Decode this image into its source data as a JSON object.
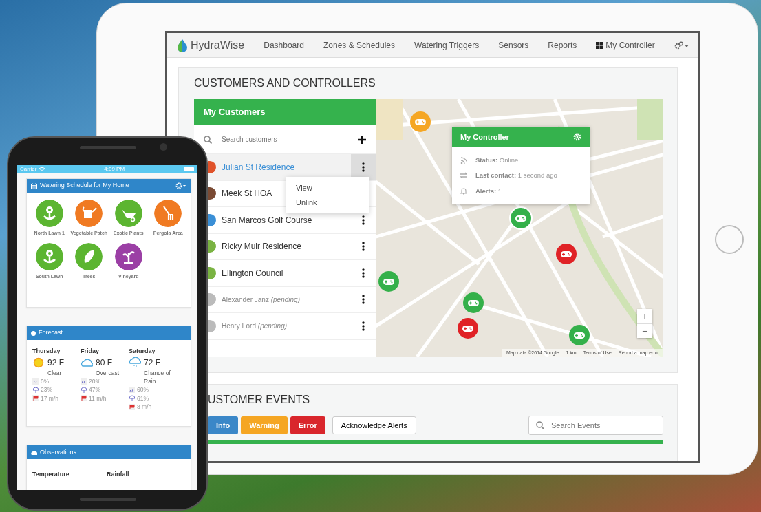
{
  "tablet": {
    "navbar": {
      "brand": "HydraWise",
      "items": [
        "Dashboard",
        "Zones & Schedules",
        "Watering Triggers",
        "Sensors",
        "Reports"
      ],
      "controller": "My Controller"
    },
    "customers_section": {
      "title": "CUSTOMERS AND CONTROLLERS",
      "list_title": "My Customers",
      "search": {
        "placeholder": "Search customers"
      },
      "customers": [
        {
          "name": "Julian St Residence",
          "color": "#e0522a",
          "selected": true,
          "pending": false
        },
        {
          "name": "Meek St HOA",
          "color": "#7a4a33",
          "selected": false,
          "pending": false
        },
        {
          "name": "San Marcos Golf Course",
          "color": "#3a8fd6",
          "selected": false,
          "pending": false
        },
        {
          "name": "Ricky Muir Residence",
          "color": "#7ab342",
          "selected": false,
          "pending": false
        },
        {
          "name": "Ellington Council",
          "color": "#7ab342",
          "selected": false,
          "pending": false
        },
        {
          "name": "Alexander Janz *(pending)*",
          "color": "#bbbbbb",
          "selected": false,
          "pending": true
        },
        {
          "name": "Henry Ford *(pending)*",
          "color": "#bbbbbb",
          "selected": false,
          "pending": true
        }
      ],
      "context_menu": [
        "View",
        "Unlink"
      ],
      "map": {
        "markers": [
          {
            "color": "#f5a623",
            "selected": false
          },
          {
            "color": "#34b04a",
            "selected": true
          },
          {
            "color": "#e02226",
            "selected": false
          },
          {
            "color": "#34b04a",
            "selected": false
          },
          {
            "color": "#34b04a",
            "selected": false
          },
          {
            "color": "#e02226",
            "selected": false
          },
          {
            "color": "#34b04a",
            "selected": false
          }
        ],
        "popup": {
          "title": "My Controller",
          "rows": [
            "**Status:** Online",
            "**Last contact:** 1 second ago",
            "**Alerts:** 1"
          ]
        },
        "zoom": [
          "+",
          "−"
        ],
        "attribution": [
          "Map data ©2014 Google",
          "1 km",
          "Terms of Use",
          "Report a map error"
        ]
      }
    },
    "events_section": {
      "title": "USTOMER EVENTS",
      "filters": [
        {
          "label": "Info",
          "color": "#3a87c8"
        },
        {
          "label": "Warning",
          "color": "#f5a623"
        },
        {
          "label": "Error",
          "color": "#d9262c"
        }
      ],
      "acknowledge": "Acknowledge Alerts",
      "search": {
        "placeholder": "Search Events"
      }
    }
  },
  "phone": {
    "status_bar": {
      "carrier": "Carrier",
      "time": "4:09 PM"
    },
    "schedule": {
      "title": "Watering Schedule for My Home",
      "zones": [
        {
          "label": "North Lawn 1",
          "color": "#5cb531"
        },
        {
          "label": "Vegetable Patch",
          "color": "#f07a22"
        },
        {
          "label": "Exotic Plants",
          "color": "#5cb531"
        },
        {
          "label": "Pergola Area",
          "color": "#f07a22"
        },
        {
          "label": "South Lawn",
          "color": "#5cb531"
        },
        {
          "label": "Trees",
          "color": "#5cb531"
        },
        {
          "label": "Vineyard",
          "color": "#9b3fa5"
        }
      ]
    },
    "forecast": {
      "title": "Forecast",
      "days": [
        {
          "day": "Thursday",
          "temp": "92 F",
          "condition": "Clear",
          "rain": "0%",
          "cloud": "23%",
          "wind": "17 m/h"
        },
        {
          "day": "Friday",
          "temp": "80 F",
          "condition": "Overcast",
          "rain": "20%",
          "cloud": "47%",
          "wind": "11 m/h"
        },
        {
          "day": "Saturday",
          "temp": "72 F",
          "condition": "Chance of Rain",
          "rain": "60%",
          "cloud": "61%",
          "wind": "8 m/h"
        }
      ]
    },
    "observations": {
      "title": "Observations",
      "columns": [
        "Temperature",
        "Rainfall"
      ]
    }
  }
}
